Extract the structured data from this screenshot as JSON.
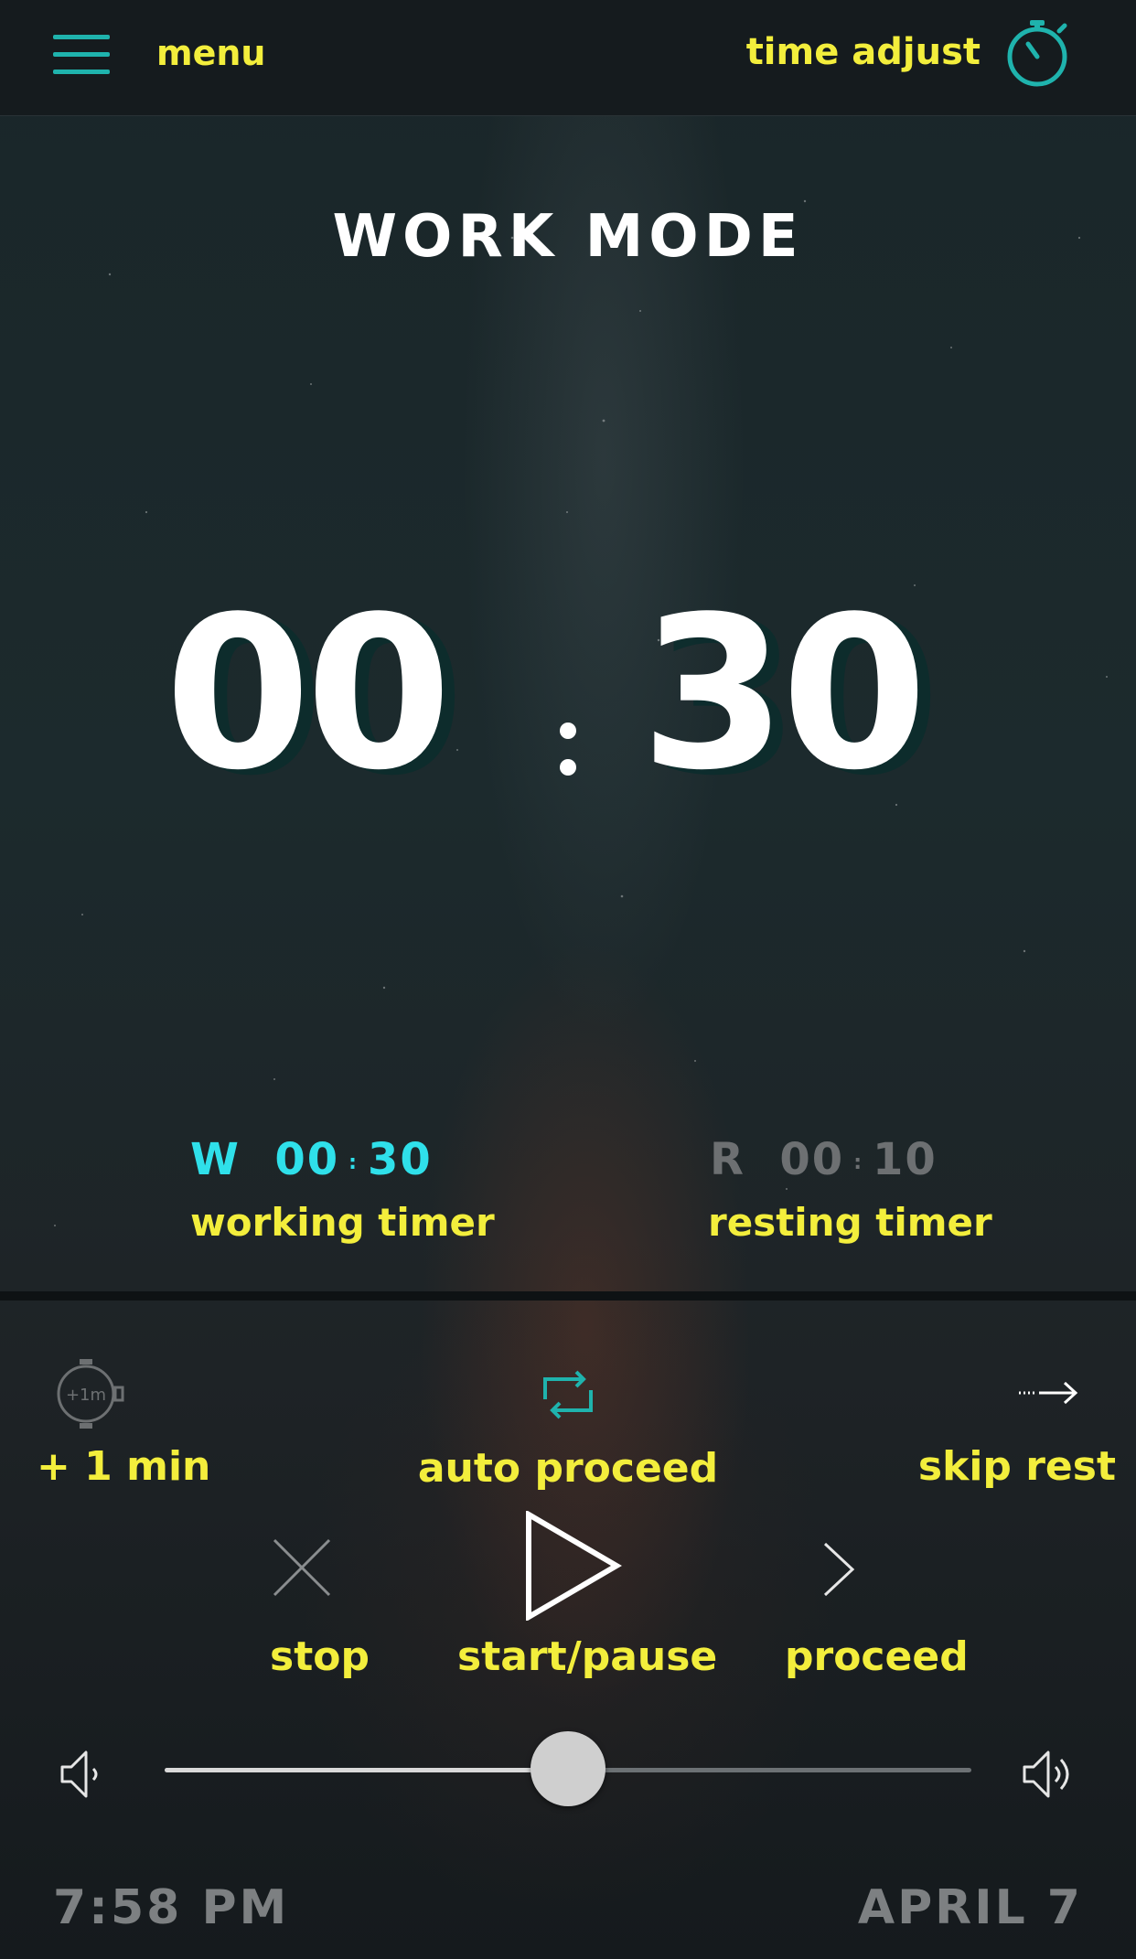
{
  "header": {
    "menu_label": "menu",
    "time_adjust_label": "time adjust",
    "menu_icon": "hamburger-icon",
    "time_adjust_icon": "stopwatch-icon"
  },
  "mode_title": "WORK MODE",
  "main_timer": {
    "minutes": "00",
    "seconds": "30"
  },
  "working_timer": {
    "prefix": "W",
    "minutes": "00",
    "seconds": "30",
    "label": "working timer"
  },
  "resting_timer": {
    "prefix": "R",
    "minutes": "00",
    "seconds": "10",
    "label": "resting timer"
  },
  "controls": {
    "plus_one": {
      "icon_text": "+1m",
      "label": "+ 1 min"
    },
    "auto_proceed": {
      "label": "auto proceed"
    },
    "skip_rest": {
      "label": "skip rest"
    },
    "stop": {
      "label": "stop"
    },
    "start_pause": {
      "label": "start/pause"
    },
    "proceed": {
      "label": "proceed"
    }
  },
  "volume": {
    "level": 0.5
  },
  "footer": {
    "time": "7:58 PM",
    "date": "APRIL 7"
  },
  "colors": {
    "accent_teal": "#1fb3ad",
    "label_yellow": "#f3ee3c",
    "work_cyan": "#2fe0ea",
    "rest_gray": "#6d7072"
  }
}
